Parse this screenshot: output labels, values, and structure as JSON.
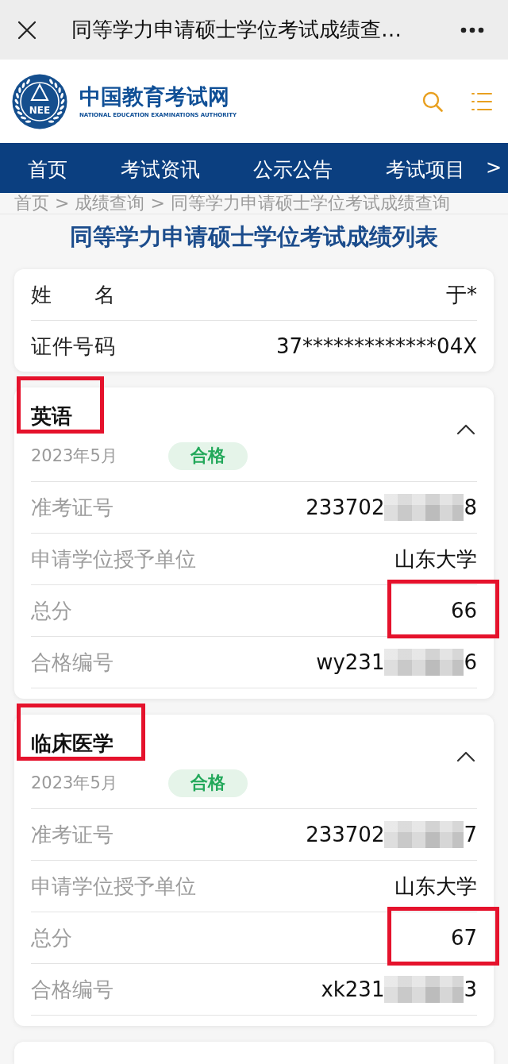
{
  "top_bar": {
    "title": "同等学力申请硕士学位考试成绩查…"
  },
  "site_header": {
    "logo_text": "NEE",
    "name": "中国教育考试网",
    "subtitle": "NATIONAL EDUCATION EXAMINATIONS AUTHORITY"
  },
  "nav": {
    "items": [
      {
        "label": "首页",
        "selected": false
      },
      {
        "label": "考试资讯",
        "selected": false
      },
      {
        "label": "公示公告",
        "selected": false
      },
      {
        "label": "考试项目",
        "selected": false
      }
    ],
    "more": ">"
  },
  "breadcrumb": {
    "items": [
      "首页",
      "成绩查询",
      "同等学力申请硕士学位考试成绩查询"
    ],
    "separators": [
      ">",
      ">"
    ]
  },
  "page_title": "同等学力申请硕士学位考试成绩列表",
  "identity": {
    "rows": [
      {
        "label": "姓名",
        "value": "于*"
      },
      {
        "label": "证件号码",
        "value": "37*************04X"
      }
    ]
  },
  "subjects": [
    {
      "title": "英语",
      "title_highlighted": true,
      "expanded": true,
      "date": "2023年5月",
      "status": "合格",
      "rows": [
        {
          "kind": "redacted",
          "label": "准考证号",
          "value": "233702",
          "value_end": "8",
          "highlighted": false
        },
        {
          "kind": "plain",
          "label": "申请学位授予单位",
          "value": "山东大学",
          "highlighted": false
        },
        {
          "kind": "plain",
          "label": "总分",
          "value": "66",
          "highlighted": true
        },
        {
          "kind": "redacted",
          "label": "合格编号",
          "value": "wy231",
          "value_end": "6",
          "highlighted": false
        }
      ]
    },
    {
      "title": "临床医学",
      "title_highlighted": true,
      "expanded": true,
      "date": "2023年5月",
      "status": "合格",
      "rows": [
        {
          "kind": "redacted",
          "label": "准考证号",
          "value": "233702",
          "value_end": "7",
          "highlighted": false
        },
        {
          "kind": "plain",
          "label": "申请学位授予单位",
          "value": "山东大学",
          "highlighted": false
        },
        {
          "kind": "plain",
          "label": "总分",
          "value": "67",
          "highlighted": true
        },
        {
          "kind": "redacted",
          "label": "合格编号",
          "value": "xk231",
          "value_end": "3",
          "highlighted": false
        }
      ]
    }
  ]
}
